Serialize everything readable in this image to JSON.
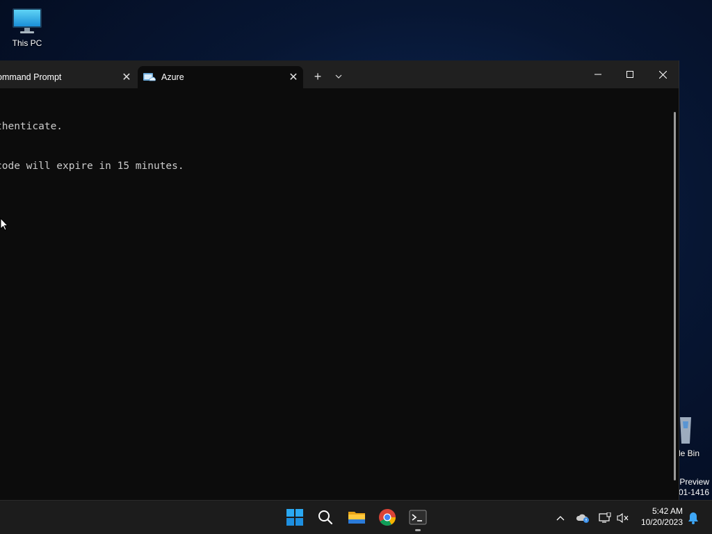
{
  "desktop": {
    "icons": [
      {
        "label": "This PC"
      },
      {
        "label": "le Bin"
      }
    ],
    "watermark": [
      "Preview",
      "01-1416"
    ]
  },
  "terminal": {
    "tabs": [
      {
        "label": "ommand Prompt"
      },
      {
        "label": "Azure"
      }
    ],
    "console_lines": [
      "thenticate.",
      "code will expire in 15 minutes."
    ]
  },
  "taskbar": {
    "apps": [
      "start-icon",
      "search-icon",
      "file-explorer-icon",
      "chrome-icon",
      "terminal-icon"
    ],
    "clock": {
      "time": "5:42 AM",
      "date": "10/20/2023"
    }
  },
  "colors": {
    "terminal_bg": "#0c0c0c",
    "titlebar_bg": "#202020",
    "taskbar_bg": "#1c1c1c",
    "start_blue": "#0078d4"
  }
}
